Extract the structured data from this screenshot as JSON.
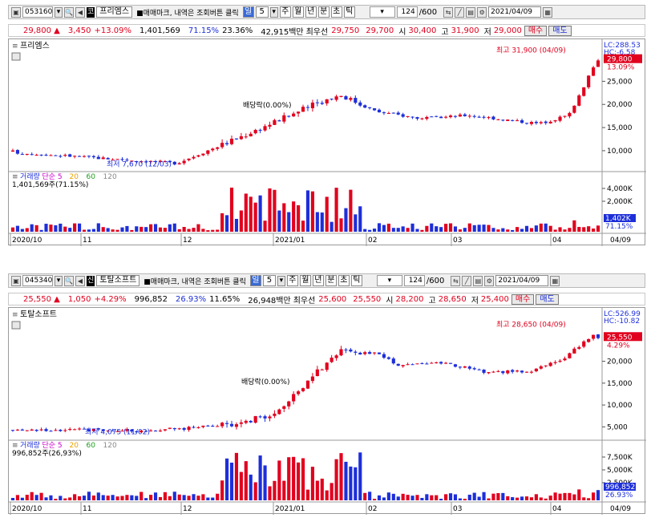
{
  "charts": [
    {
      "code": "053160",
      "market_tag": "코",
      "name": "프리엠스",
      "hint": "■매매마크, 내역은 조회버튼 클릭",
      "periods": [
        "일",
        "주",
        "월",
        "년",
        "분",
        "초",
        "틱"
      ],
      "selected_period": "일",
      "period_n": "5",
      "count": "124",
      "count_max": "/600",
      "date": "2021/04/09",
      "status": {
        "price": "29,800 ▲",
        "change": "3,450",
        "change_pct": "+13.09%",
        "volume": "1,401,569",
        "vol_ratio": "71.15%",
        "turnover": "23.36%",
        "amount": "42,915백만",
        "best_label": "최우선",
        "best_ask": "29,750",
        "best_bid": "29,700",
        "open_label": "시",
        "open": "30,400",
        "high_label": "고",
        "high": "31,900",
        "low_label": "저",
        "low": "29,000",
        "buy": "매수",
        "sell": "매도"
      },
      "chart_title": "프리엠스",
      "vol_legend": [
        "거래량",
        "단순 5",
        "20",
        "60",
        "120"
      ],
      "vol_text": "1,401,569주(71.15%)",
      "price_axis": [
        "25,000",
        "20,000",
        "15,000",
        "10,000"
      ],
      "vol_axis": [
        "4,000K",
        "2,000K"
      ],
      "x_labels": [
        "2020/10",
        "11",
        "12",
        "2021/01",
        "02",
        "03",
        "04"
      ],
      "x_end": "04/09",
      "lc": "LC:288.53",
      "hc": "HC:-6.58",
      "cur_tag": "29,800",
      "pct_tag": "13.09%",
      "vol_tag": "1,402K",
      "vol_pct_tag": "71.15%",
      "max_ann": "최고 31,900 (04/09)",
      "min_ann": "최저 7,670 (12/03)",
      "div_ann": "배당락(0.00%)",
      "chart_data": {
        "type": "candlestick",
        "ylim": [
          6000,
          32000
        ],
        "start": 9800,
        "end": 29800,
        "max": 31900,
        "min": 7670
      }
    },
    {
      "code": "045340",
      "market_tag": "신",
      "name": "토탈소프트",
      "hint": "■매매마크, 내역은 조회버튼 클릭",
      "periods": [
        "일",
        "주",
        "월",
        "년",
        "분",
        "초",
        "틱"
      ],
      "selected_period": "일",
      "period_n": "5",
      "count": "124",
      "count_max": "/600",
      "date": "2021/04/09",
      "status": {
        "price": "25,550 ▲",
        "change": "1,050",
        "change_pct": "+4.29%",
        "volume": "996,852",
        "vol_ratio": "26.93%",
        "turnover": "11.65%",
        "amount": "26,948백만",
        "best_label": "최우선",
        "best_ask": "25,600",
        "best_bid": "25,550",
        "open_label": "시",
        "open": "28,200",
        "high_label": "고",
        "high": "28,650",
        "low_label": "저",
        "low": "25,400",
        "buy": "매수",
        "sell": "매도"
      },
      "chart_title": "토탈소프트",
      "vol_legend": [
        "거래량",
        "단순 5",
        "20",
        "60",
        "120"
      ],
      "vol_text": "996,852주(26,93%)",
      "price_axis": [
        "20,000",
        "15,000",
        "10,000",
        "5,000"
      ],
      "vol_axis": [
        "7,500K",
        "5,000K",
        "2,500K"
      ],
      "x_labels": [
        "2020/10",
        "11",
        "12",
        "2021/01",
        "02",
        "03",
        "04"
      ],
      "x_end": "04/09",
      "lc": "LC:526.99",
      "hc": "HC:-10.82",
      "cur_tag": "25,550",
      "pct_tag": "4.29%",
      "vol_tag": "996,852",
      "vol_pct_tag": "26.93%",
      "max_ann": "최고 28,650 (04/09)",
      "min_ann": "최저 4,075 (11/02)",
      "div_ann": "배당락(0.00%)",
      "chart_data": {
        "type": "candlestick",
        "ylim": [
          2500,
          30000
        ],
        "start": 4300,
        "end": 25550,
        "max": 28650,
        "min": 4075
      }
    }
  ]
}
